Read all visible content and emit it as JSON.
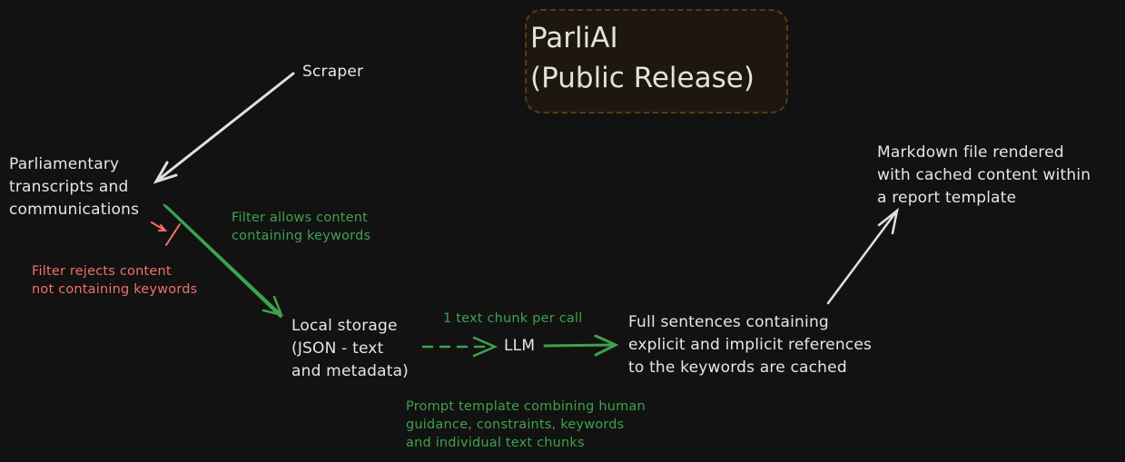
{
  "title": {
    "line1": "ParliAI",
    "line2": "(Public Release)"
  },
  "nodes": {
    "scraper": "Scraper",
    "transcripts": [
      "Parliamentary",
      "transcripts and",
      "communications"
    ],
    "local_storage": [
      "Local storage",
      "(JSON - text",
      "and metadata)"
    ],
    "llm": "LLM",
    "cached": [
      "Full sentences containing",
      "explicit and implicit references",
      "to the keywords are cached"
    ],
    "markdown": [
      "Markdown file rendered",
      "with cached content within",
      "a report template"
    ]
  },
  "annotations": {
    "filter_allows": [
      "Filter allows content",
      "containing keywords"
    ],
    "filter_rejects": [
      "Filter rejects content",
      "not containing keywords"
    ],
    "chunk_per_call": "1 text chunk per call",
    "prompt_template": [
      "Prompt template combining human",
      "guidance, constraints, keywords",
      "and individual text chunks"
    ]
  },
  "colors": {
    "background": "#121212",
    "text": "#e6e6e6",
    "accept": "#3fa14f",
    "reject": "#f0706c",
    "title_fill": "#1d1710",
    "title_border": "#5a3a1a"
  }
}
